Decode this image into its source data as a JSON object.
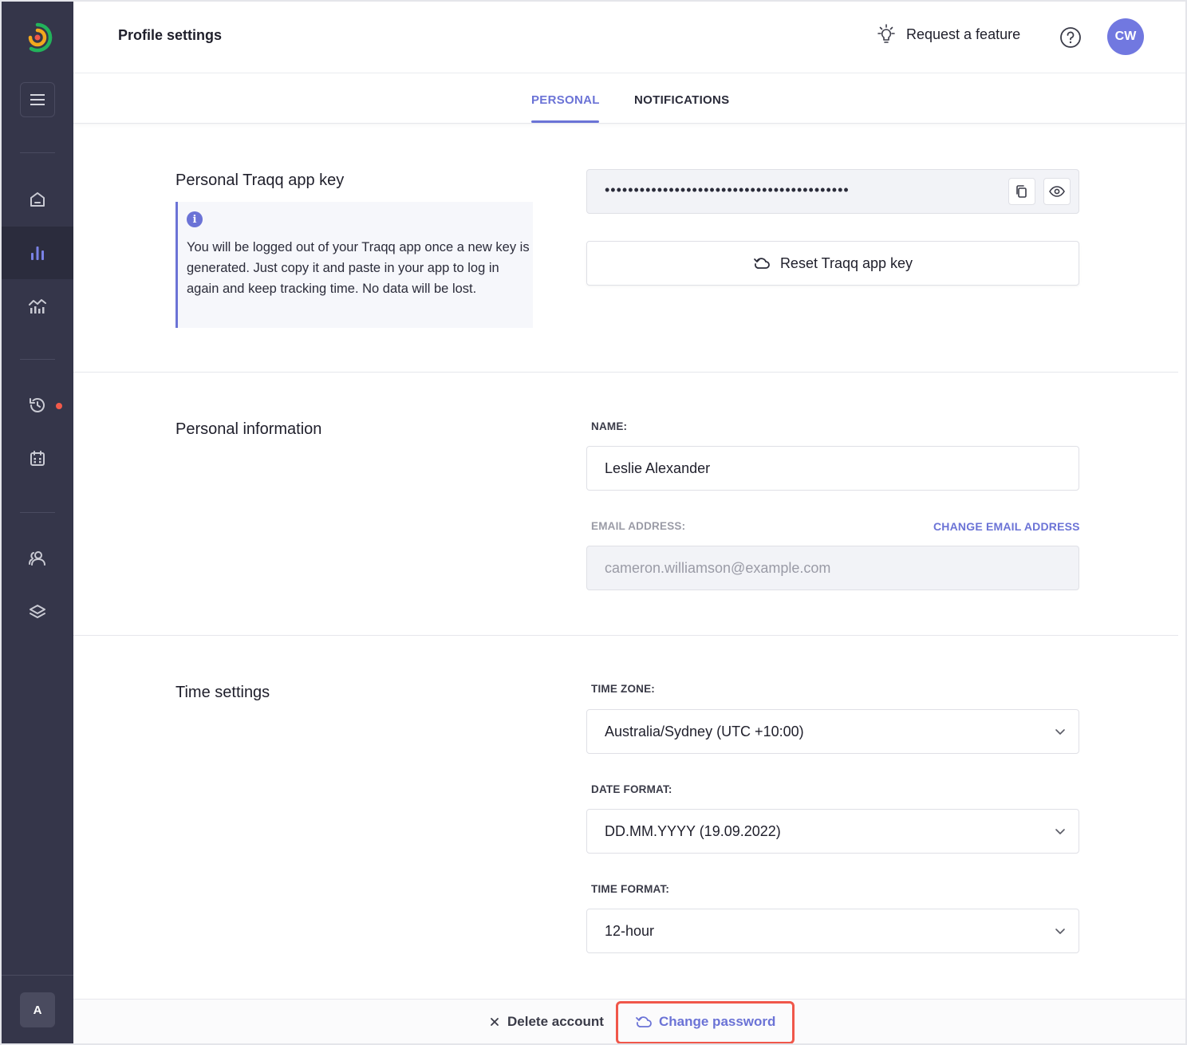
{
  "header": {
    "title": "Profile settings",
    "request_feature": "Request a feature",
    "avatar_initials": "CW"
  },
  "tabs": [
    {
      "label": "PERSONAL",
      "active": true
    },
    {
      "label": "NOTIFICATIONS",
      "active": false
    }
  ],
  "app_key": {
    "title": "Personal Traqq app key",
    "info_icon": "i",
    "info_text": "You will be logged out of your Traqq app once a new key is generated. Just copy it and paste in your app to log in again and keep tracking time. No data will be lost.",
    "masked_value": "••••••••••••••••••••••••••••••••••••••••••",
    "reset_label": "Reset Traqq app key"
  },
  "personal_info": {
    "title": "Personal information",
    "name_label": "NAME:",
    "name_value": "Leslie Alexander",
    "email_label": "EMAIL ADDRESS:",
    "change_email_label": "CHANGE EMAIL ADDRESS",
    "email_value": "cameron.williamson@example.com"
  },
  "time_settings": {
    "title": "Time settings",
    "timezone_label": "TIME ZONE:",
    "timezone_value": "Australia/Sydney (UTC +10:00)",
    "date_format_label": "DATE FORMAT:",
    "date_format_value": "DD.MM.YYYY (19.09.2022)",
    "time_format_label": "TIME FORMAT:",
    "time_format_value": "12-hour"
  },
  "footer": {
    "delete_account": "Delete account",
    "change_password": "Change password"
  },
  "sidebar": {
    "user_initial": "A",
    "icons": [
      "home-icon",
      "bar-chart-icon",
      "analytics-icon",
      "history-icon",
      "calendar-icon",
      "team-icon",
      "layers-icon"
    ]
  },
  "colors": {
    "accent": "#6b73d6",
    "sidebar_bg": "#35364a",
    "highlight": "#f0574a",
    "notification_dot": "#f25a4a"
  }
}
